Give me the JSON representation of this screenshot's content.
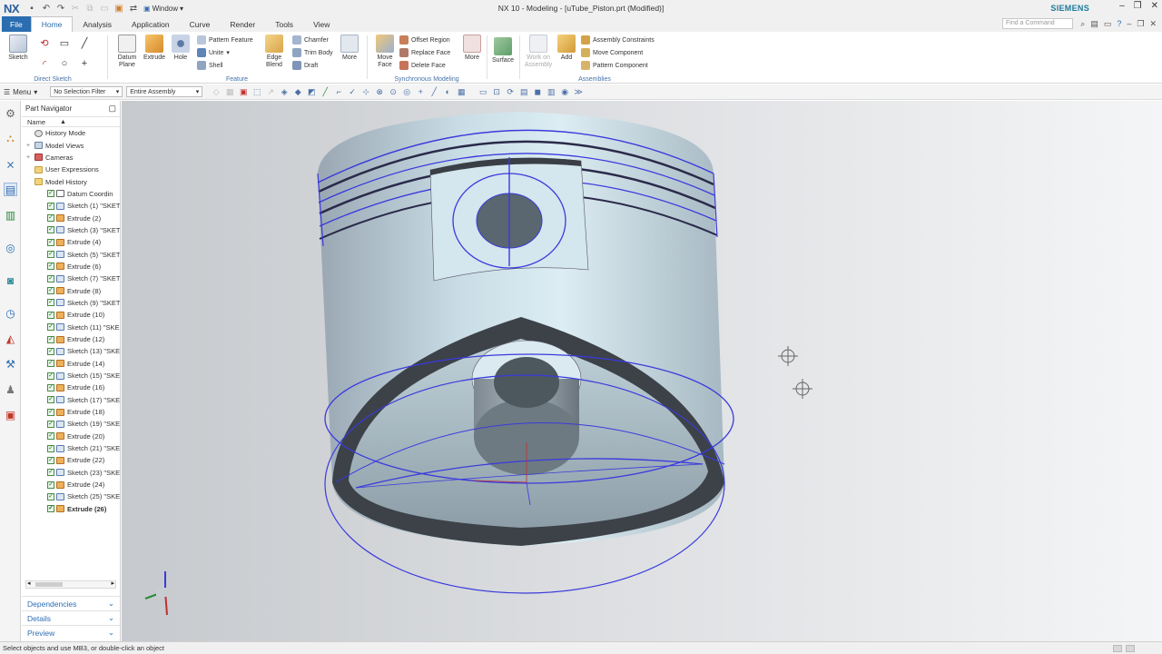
{
  "app": {
    "logo": "NX",
    "title": "NX 10 - Modeling - [uTube_Piston.prt (Modified)]",
    "window_menu": "Window",
    "brand": "SIEMENS",
    "find_placeholder": "Find a Command"
  },
  "tabs": [
    "File",
    "Home",
    "Analysis",
    "Application",
    "Curve",
    "Render",
    "Tools",
    "View"
  ],
  "active_tab": "Home",
  "ribbon": {
    "direct_sketch": {
      "label": "Direct Sketch",
      "sketch": "Sketch"
    },
    "feature": {
      "label": "Feature",
      "datum_plane": "Datum\nPlane",
      "extrude": "Extrude",
      "hole": "Hole",
      "pattern_feature": "Pattern Feature",
      "unite": "Unite",
      "shell": "Shell",
      "edge_blend": "Edge\nBlend",
      "chamfer": "Chamfer",
      "trim_body": "Trim Body",
      "draft": "Draft",
      "more": "More"
    },
    "sync": {
      "label": "Synchronous Modeling",
      "move_face": "Move\nFace",
      "offset_region": "Offset Region",
      "replace_face": "Replace Face",
      "delete_face": "Delete Face",
      "more": "More"
    },
    "surface": {
      "label": "Surface"
    },
    "assemblies": {
      "label": "Assemblies",
      "work_on_assembly": "Work on\nAssembly",
      "add": "Add",
      "assembly_constraints": "Assembly Constraints",
      "move_component": "Move Component",
      "pattern_component": "Pattern Component"
    }
  },
  "selection": {
    "menu": "Menu",
    "filter": "No Selection Filter",
    "scope": "Entire Assembly"
  },
  "navigator": {
    "title": "Part Navigator",
    "column": "Name",
    "items": [
      {
        "label": "History Mode",
        "indent": 1,
        "kind": "clock"
      },
      {
        "label": "Model Views",
        "indent": 1,
        "kind": "views"
      },
      {
        "label": "Cameras",
        "indent": 1,
        "kind": "camera"
      },
      {
        "label": "User Expressions",
        "indent": 1,
        "kind": "folder"
      },
      {
        "label": "Model History",
        "indent": 1,
        "kind": "folder"
      },
      {
        "label": "Datum Coordin",
        "indent": 2,
        "kind": "datum"
      },
      {
        "label": "Sketch (1) \"SKET",
        "indent": 2,
        "kind": "sketch"
      },
      {
        "label": "Extrude (2)",
        "indent": 2,
        "kind": "extrude"
      },
      {
        "label": "Sketch (3) \"SKET",
        "indent": 2,
        "kind": "sketch"
      },
      {
        "label": "Extrude (4)",
        "indent": 2,
        "kind": "extrude"
      },
      {
        "label": "Sketch (5) \"SKET",
        "indent": 2,
        "kind": "sketch"
      },
      {
        "label": "Extrude (6)",
        "indent": 2,
        "kind": "extrude"
      },
      {
        "label": "Sketch (7) \"SKET",
        "indent": 2,
        "kind": "sketch"
      },
      {
        "label": "Extrude (8)",
        "indent": 2,
        "kind": "extrude"
      },
      {
        "label": "Sketch (9) \"SKET",
        "indent": 2,
        "kind": "sketch"
      },
      {
        "label": "Extrude (10)",
        "indent": 2,
        "kind": "extrude"
      },
      {
        "label": "Sketch (11) \"SKE",
        "indent": 2,
        "kind": "sketch"
      },
      {
        "label": "Extrude (12)",
        "indent": 2,
        "kind": "extrude"
      },
      {
        "label": "Sketch (13) \"SKE",
        "indent": 2,
        "kind": "sketch"
      },
      {
        "label": "Extrude (14)",
        "indent": 2,
        "kind": "extrude"
      },
      {
        "label": "Sketch (15) \"SKE",
        "indent": 2,
        "kind": "sketch"
      },
      {
        "label": "Extrude (16)",
        "indent": 2,
        "kind": "extrude"
      },
      {
        "label": "Sketch (17) \"SKE",
        "indent": 2,
        "kind": "sketch"
      },
      {
        "label": "Extrude (18)",
        "indent": 2,
        "kind": "extrude"
      },
      {
        "label": "Sketch (19) \"SKE",
        "indent": 2,
        "kind": "sketch"
      },
      {
        "label": "Extrude (20)",
        "indent": 2,
        "kind": "extrude"
      },
      {
        "label": "Sketch (21) \"SKE",
        "indent": 2,
        "kind": "sketch"
      },
      {
        "label": "Extrude (22)",
        "indent": 2,
        "kind": "extrude"
      },
      {
        "label": "Sketch (23) \"SKE",
        "indent": 2,
        "kind": "sketch"
      },
      {
        "label": "Extrude (24)",
        "indent": 2,
        "kind": "extrude"
      },
      {
        "label": "Sketch (25) \"SKE",
        "indent": 2,
        "kind": "sketch"
      },
      {
        "label": "Extrude (26)",
        "indent": 2,
        "kind": "extrude",
        "bold": true
      }
    ],
    "sections": [
      "Dependencies",
      "Details",
      "Preview"
    ]
  },
  "status": "Select objects and use MB3, or double-click an object",
  "colors": {
    "accent": "#2a6db0",
    "brand": "#1b7a9b",
    "edge": "#3a3adc"
  }
}
